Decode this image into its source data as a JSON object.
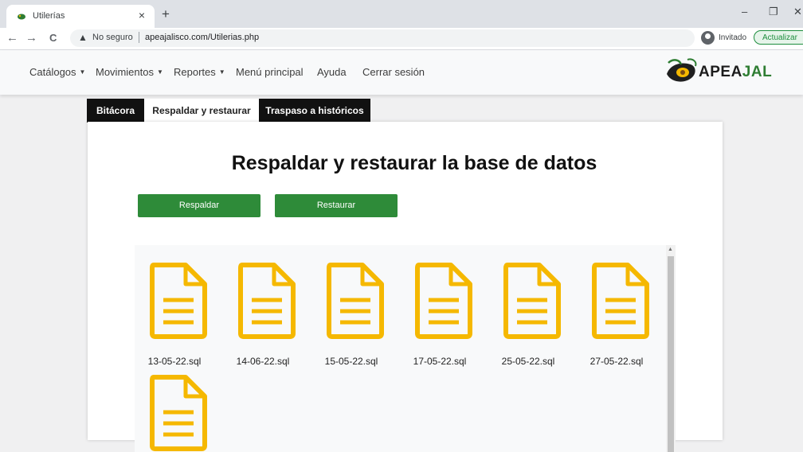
{
  "browser": {
    "tab_title": "Utilerías",
    "tab_close": "×",
    "new_tab": "+",
    "minimize": "–",
    "restore": "❐",
    "close": "✕",
    "back": "←",
    "forward": "→",
    "reload": "C",
    "security_label": "No seguro",
    "url": "apeajalisco.com/Utilerias.php",
    "profile_label": "Invitado",
    "update_label": "Actualizar"
  },
  "navbar": {
    "items": [
      {
        "label": "Catálogos",
        "dropdown": true
      },
      {
        "label": "Movimientos",
        "dropdown": true
      },
      {
        "label": "Reportes",
        "dropdown": true
      },
      {
        "label": "Menú principal",
        "dropdown": false
      },
      {
        "label": "Ayuda",
        "dropdown": false
      },
      {
        "label": "Cerrar sesión",
        "dropdown": false
      }
    ],
    "logo_text_1": "APEA",
    "logo_text_2": "JAL"
  },
  "tabs": [
    {
      "label": "Bitácora",
      "active": false
    },
    {
      "label": "Respaldar y restaurar",
      "active": true
    },
    {
      "label": "Traspaso a históricos",
      "active": false
    }
  ],
  "main": {
    "title": "Respaldar y restaurar la base de datos",
    "backup_button": "Respaldar",
    "restore_button": "Restaurar"
  },
  "files": [
    {
      "name": "13-05-22.sql"
    },
    {
      "name": "14-06-22.sql"
    },
    {
      "name": "15-05-22.sql"
    },
    {
      "name": "17-05-22.sql"
    },
    {
      "name": "25-05-22.sql"
    },
    {
      "name": "27-05-22.sql"
    },
    {
      "name": ""
    }
  ],
  "colors": {
    "accent_green": "#2e8b39",
    "file_icon": "#f5b800",
    "dark_tab": "#111111"
  }
}
